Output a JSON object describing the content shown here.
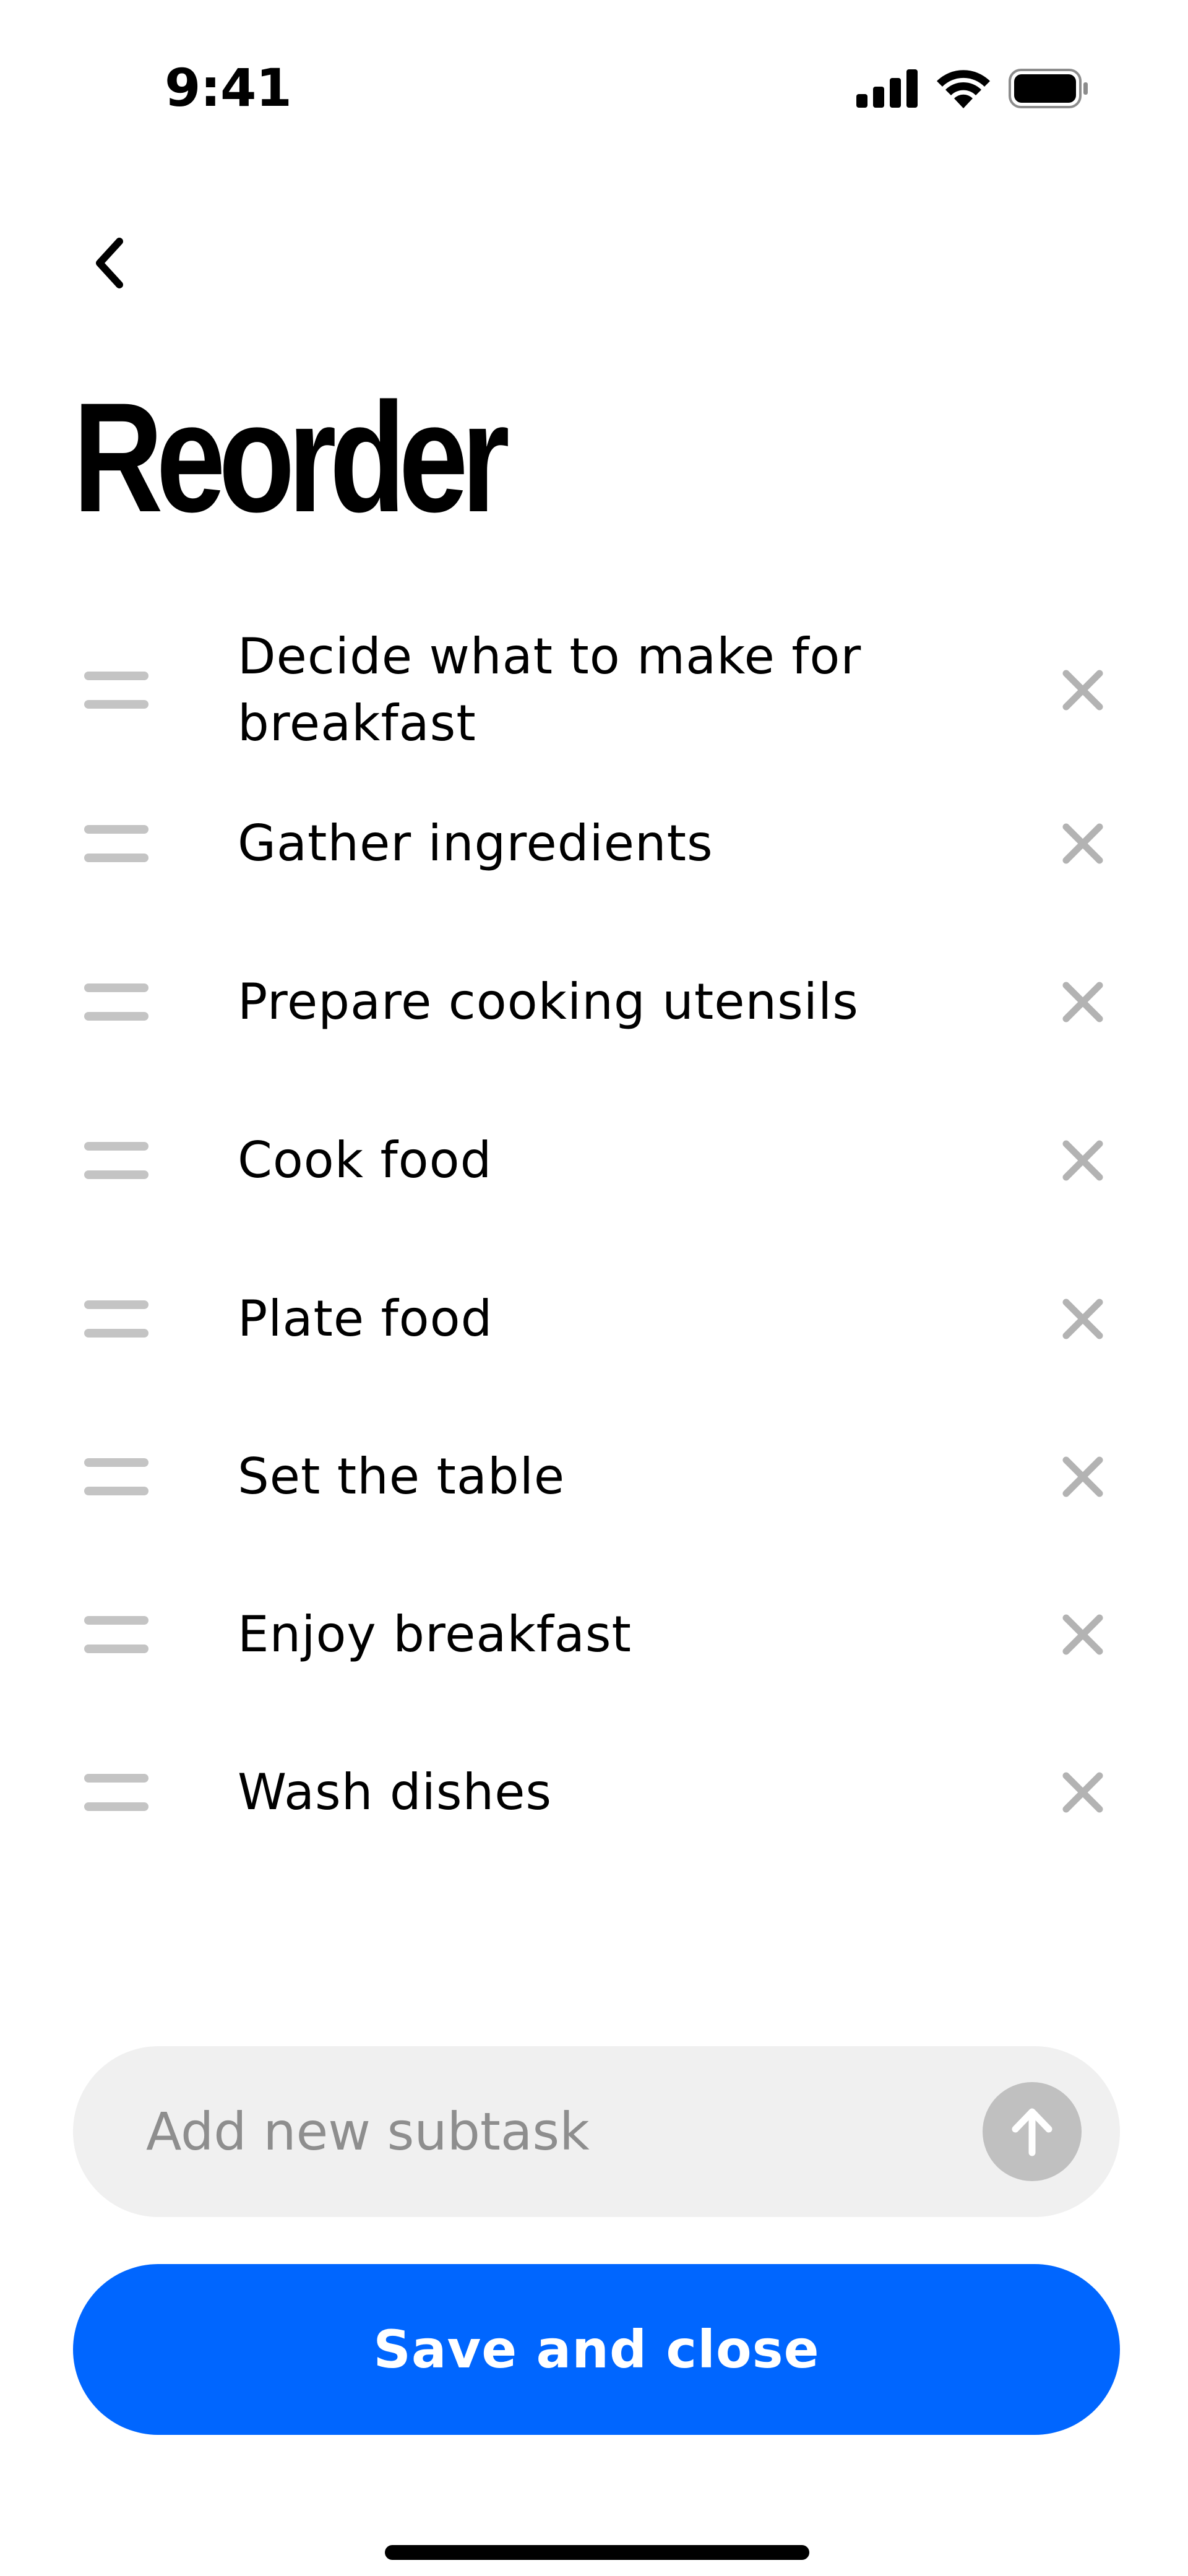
{
  "status_bar": {
    "time": "9:41",
    "icons": [
      "cellular-signal-icon",
      "wifi-icon",
      "battery-icon"
    ]
  },
  "header": {
    "back_icon": "chevron-left-icon",
    "title": "Reorder"
  },
  "subtasks": [
    {
      "label": "Decide what to make for breakfast"
    },
    {
      "label": "Gather ingredients"
    },
    {
      "label": "Prepare cooking utensils"
    },
    {
      "label": "Cook food"
    },
    {
      "label": "Plate food"
    },
    {
      "label": "Set the table"
    },
    {
      "label": "Enjoy breakfast"
    },
    {
      "label": "Wash dishes"
    }
  ],
  "add_subtask": {
    "placeholder": "Add new subtask",
    "value": "",
    "submit_icon": "arrow-up-icon"
  },
  "actions": {
    "save_label": "Save and close"
  },
  "colors": {
    "primary": "#0066ff",
    "text": "#000000",
    "muted": "#8e8e8e",
    "handle": "#c4c4c4",
    "input_bg": "#f0f0f0",
    "submit_bg": "#c0c0c0"
  }
}
